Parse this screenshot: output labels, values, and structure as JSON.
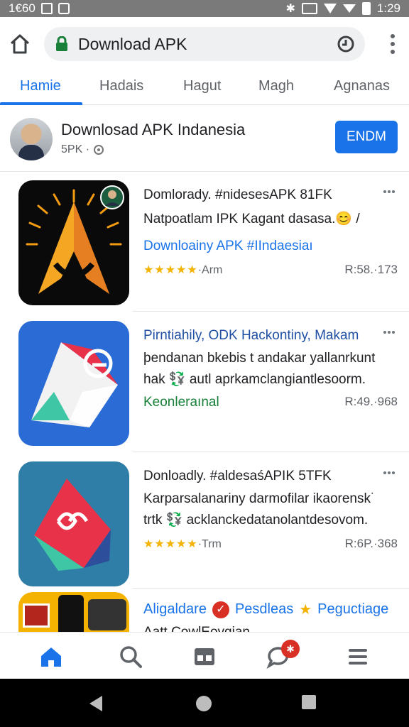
{
  "status_bar": {
    "time_left": "1€60",
    "time_right": "1:29"
  },
  "browser": {
    "url": "Download APK",
    "icons": {
      "home": "home-icon",
      "lock": "lock-icon",
      "history": "history-icon",
      "menu": "more-vert-icon"
    }
  },
  "tabs": [
    {
      "label": "Hamie"
    },
    {
      "label": "Hadais"
    },
    {
      "label": "Hagut"
    },
    {
      "label": "Magh"
    },
    {
      "label": "Agnanas"
    }
  ],
  "channel": {
    "name": "Downlosad APK Indanesia",
    "sub": "5PK ·",
    "button": "ENDM"
  },
  "cards": [
    {
      "line1": "Domlorady. #nidesesAPK 81FK",
      "line2": "Natpoatlam IPK Kagant dasasa.😊 /",
      "line3": "Downloainy APK #IIndaesiaı",
      "stars": "★★★★★",
      "rating_label": "·Arm",
      "meta": "R:58.·173"
    },
    {
      "line1": "Pirntiahily, ODK Hackontiny, Makam",
      "line2": "þendanan bkebis t andakar yallanrkunt",
      "line2b": "hak 💱 autl aprkamclangiantlesoorm.",
      "line3": "Keonleraınal",
      "meta": "R:49.·968"
    },
    {
      "line1": "Donloadly. #aldesaśAPIK 5TFK",
      "line2": "Karparsalanariny darmofilar ikaorensk˙",
      "line2b": "trtk 💱 acklanckedatanolantdesovom.",
      "stars": "★★★★★",
      "rating_label": "·Trm",
      "meta": "R:6P.·368"
    },
    {
      "line1a": "Aligaldare",
      "line1b": "Pesdleas",
      "line1c": "Peguctiage",
      "line2": "Aatt CowlEoyqian"
    }
  ],
  "bottom_nav": {
    "items": [
      "home-icon",
      "search-icon",
      "library-icon",
      "chat-icon",
      "menu-icon"
    ],
    "colors": {
      "active": "#1a73e8",
      "inactive": "#5f6368",
      "badge": "#d93025"
    }
  },
  "colors": {
    "accent": "#1a73e8",
    "status_bar": "#7a7a7a",
    "green_link": "#188038"
  }
}
